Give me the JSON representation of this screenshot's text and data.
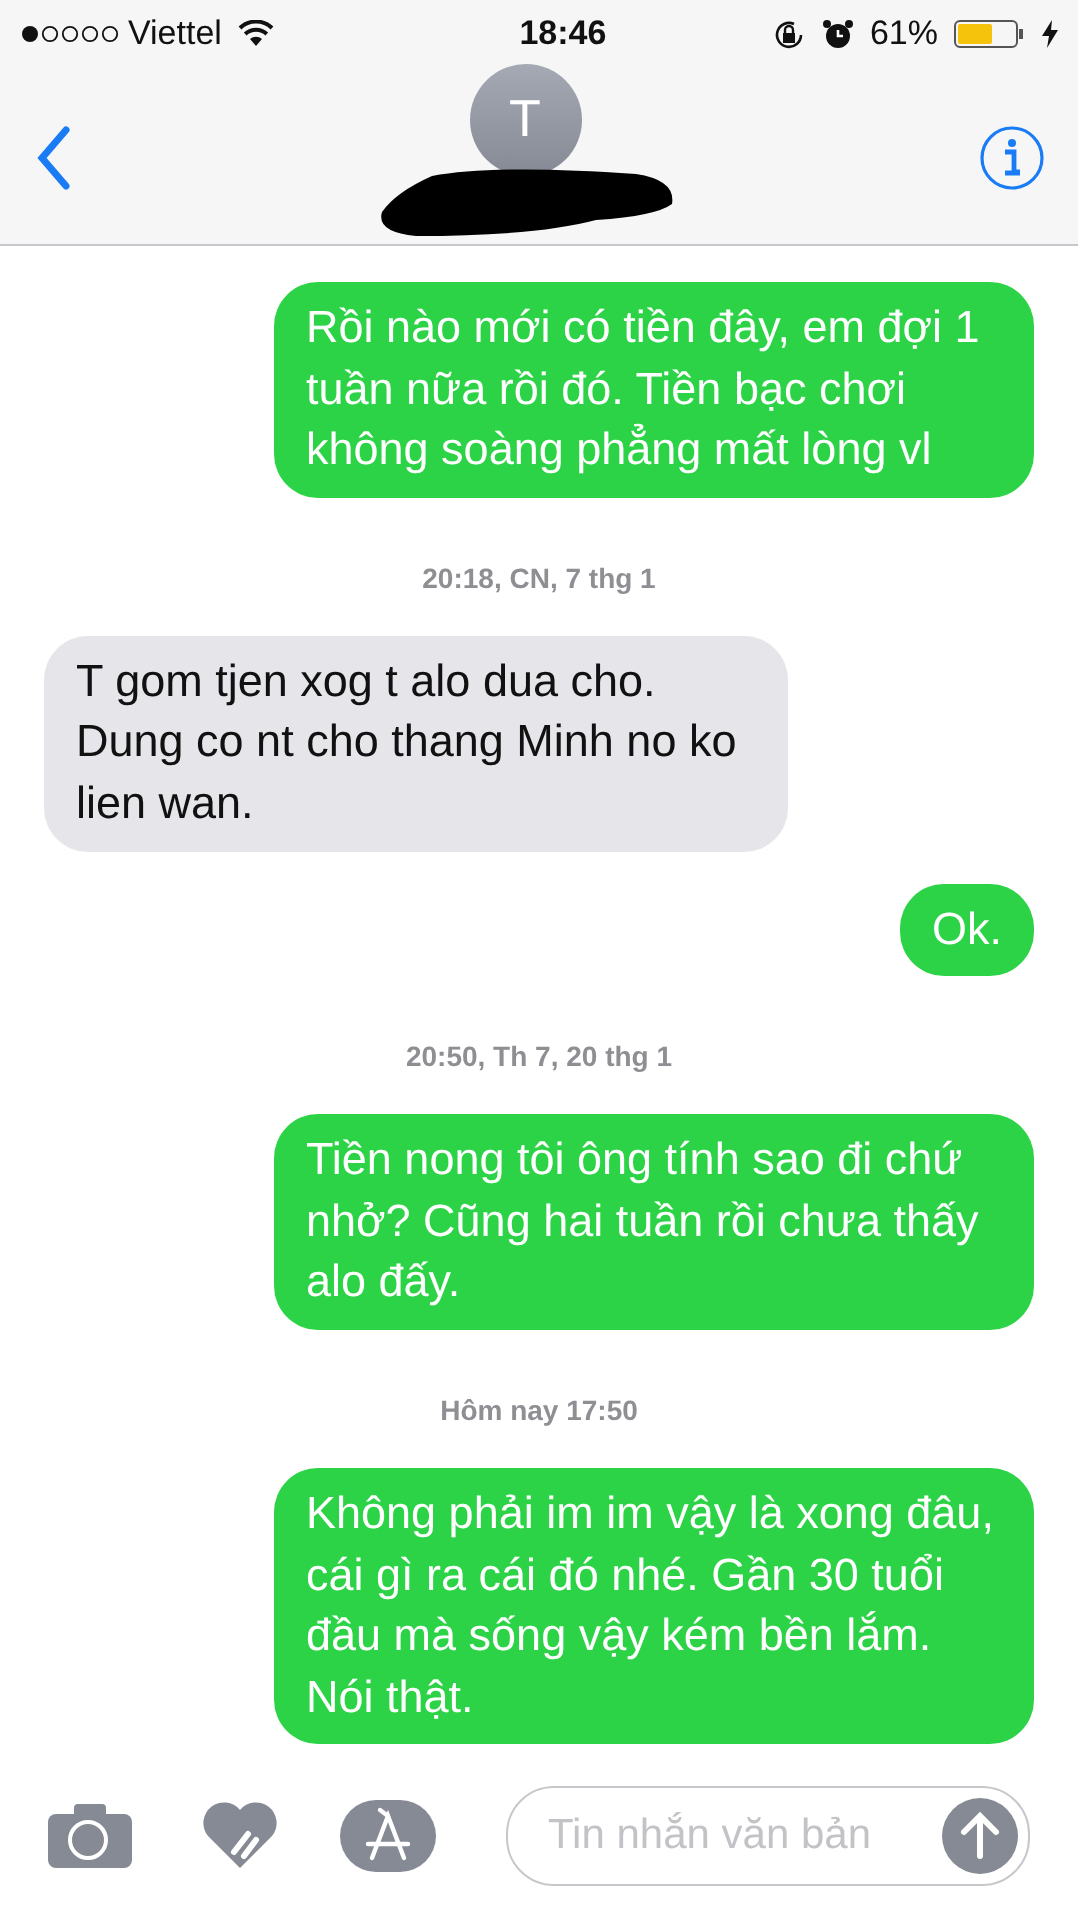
{
  "status_bar": {
    "carrier": "Viettel",
    "time": "18:46",
    "battery": "61%"
  },
  "header": {
    "avatar_initial": "T"
  },
  "messages": [
    {
      "kind": "sent",
      "text": "Rồi nào mới có tiền đây, em đợi 1 tuần nữa rồi đó. Tiền bạc chơi không soàng phẳng mất lòng vl"
    },
    {
      "kind": "time",
      "text": "20:18, CN, 7 thg 1"
    },
    {
      "kind": "received",
      "text": "T gom tjen xog t alo dua cho. Dung co nt cho thang Minh no ko lien wan."
    },
    {
      "kind": "sent",
      "text": "Ok."
    },
    {
      "kind": "time",
      "text": "20:50, Th 7, 20 thg 1"
    },
    {
      "kind": "sent",
      "text": "Tiền nong tôi ông tính sao đi chứ nhở? Cũng hai tuần rồi chưa thấy alo đấy."
    },
    {
      "kind": "time",
      "text": "Hôm nay 17:50"
    },
    {
      "kind": "sent",
      "text": "Không phải im im vậy là xong đâu, cái gì ra cái đó nhé. Gần 30 tuổi đầu mà sống vậy kém bền lắm. Nói thật."
    }
  ],
  "composer": {
    "placeholder": "Tin nhắn văn bản"
  }
}
